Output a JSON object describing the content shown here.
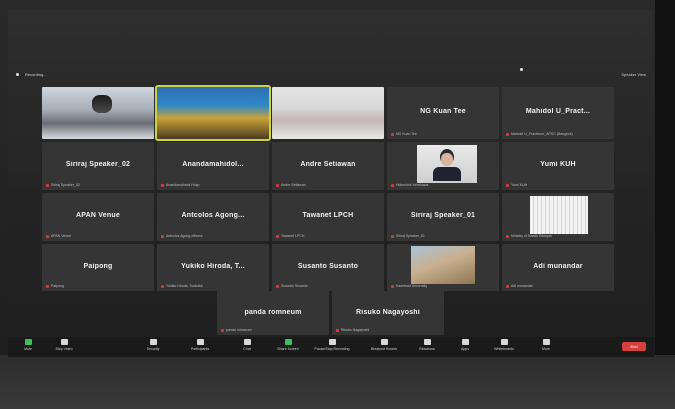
{
  "topbar": {
    "left_label": "Recording...",
    "right_label": "Speaker View"
  },
  "participants": [
    {
      "name": "",
      "sub": "",
      "video": true,
      "kind": "vid1"
    },
    {
      "name": "",
      "sub": "",
      "video": true,
      "kind": "vid2",
      "active": true
    },
    {
      "name": "",
      "sub": "",
      "video": true,
      "kind": "vid3"
    },
    {
      "name": "NG Kuan Tee",
      "sub": "NG Kuan Tee"
    },
    {
      "name": "Mahidol U_Pract...",
      "sub": "Mahidol U_Practicum_APSC (Bangkok)"
    },
    {
      "name": "Siriraj Speaker_02",
      "sub": "Siriraj Speaker_02"
    },
    {
      "name": "Anandamahidol...",
      "sub": "Anandamahidol Hosp"
    },
    {
      "name": "Andre Setiawan",
      "sub": "Andre Setiawan"
    },
    {
      "name": "",
      "sub": "Hidemichi Yonekawa",
      "video": true,
      "kind": "face"
    },
    {
      "name": "Yumi KUH",
      "sub": "Yumi KUH"
    },
    {
      "name": "APAN Venue",
      "sub": "APAN Venue"
    },
    {
      "name": "Antcolos Agong...",
      "sub": "Antcolos Agong officers"
    },
    {
      "name": "Tawanet LPCH",
      "sub": "Tawanet LPCH"
    },
    {
      "name": "Siriraj Speaker_01",
      "sub": "Siriraj Speaker_01"
    },
    {
      "name": "",
      "sub": "Ministry of Health Ethiopia",
      "video": true,
      "kind": "doc"
    },
    {
      "name": "Paipong",
      "sub": "Paipong"
    },
    {
      "name": "Yukiko Hiroda, T...",
      "sub": "Yukiko Hiroda, Tsukuba"
    },
    {
      "name": "Susanto Susanto",
      "sub": "Susanto Susanto"
    },
    {
      "name": "",
      "sub": "Kasetsart University",
      "video": true,
      "kind": "land"
    },
    {
      "name": "Adi munandar",
      "sub": "Adi munandar"
    },
    {
      "name": "panda romneum",
      "sub": "panda romneum"
    },
    {
      "name": "Risuko Nagayoshi",
      "sub": "Risuko Nagayoshi"
    }
  ],
  "toolbar": {
    "items": [
      {
        "label": "Mute",
        "icon": "microphone-icon",
        "color": "#39c15a"
      },
      {
        "label": "Stop Video",
        "icon": "camera-icon"
      },
      {
        "label": "Security",
        "icon": "shield-icon"
      },
      {
        "label": "Participants",
        "icon": "participants-icon"
      },
      {
        "label": "Chat",
        "icon": "chat-icon"
      },
      {
        "label": "Share Screen",
        "icon": "share-screen-icon",
        "color": "#39c15a"
      },
      {
        "label": "Pause/Stop Recording",
        "icon": "record-icon"
      },
      {
        "label": "Breakout Rooms",
        "icon": "breakout-icon"
      },
      {
        "label": "Reactions",
        "icon": "reactions-icon"
      },
      {
        "label": "Apps",
        "icon": "apps-icon"
      },
      {
        "label": "Whiteboards",
        "icon": "whiteboard-icon"
      },
      {
        "label": "More",
        "icon": "more-icon"
      }
    ],
    "end_label": "End",
    "end_color": "#d6403f"
  }
}
